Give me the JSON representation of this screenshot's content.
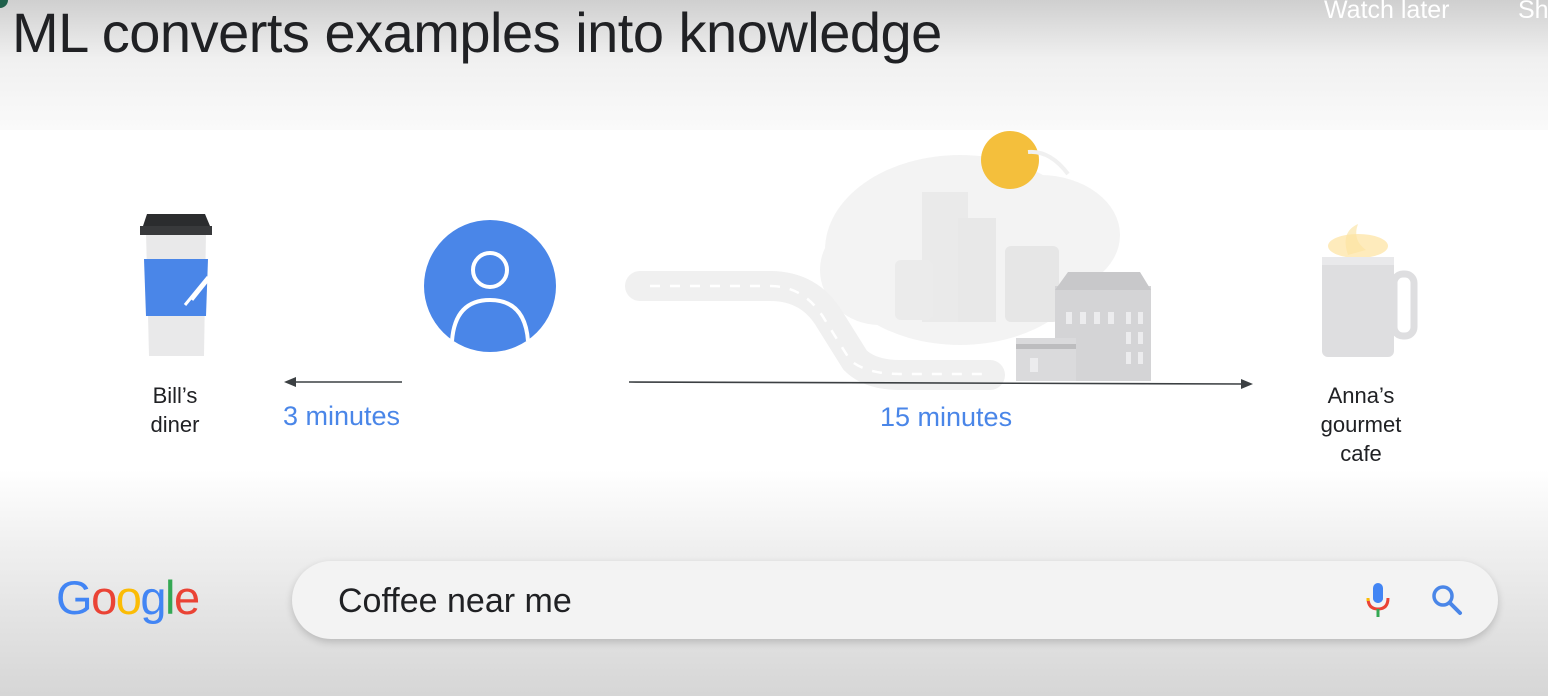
{
  "slide": {
    "title": "ML converts examples into knowledge"
  },
  "player_overlay": {
    "watch_later": "Watch later",
    "share": "Sh"
  },
  "diagram": {
    "left_place": "Bill’s\ndiner",
    "left_time": "3 minutes",
    "right_place": "Anna’s\ngourmet\ncafe",
    "right_time": "15 minutes"
  },
  "search_bar": {
    "logo": "Google",
    "query": "Coffee near me",
    "mic_icon": "microphone-icon",
    "search_icon": "magnifier-icon"
  },
  "colors": {
    "accent_blue": "#4a86e8",
    "google_blue": "#4285F4",
    "google_red": "#EA4335",
    "google_yellow": "#FBBC05",
    "google_green": "#34A853",
    "sun": "#f4bf3c"
  }
}
